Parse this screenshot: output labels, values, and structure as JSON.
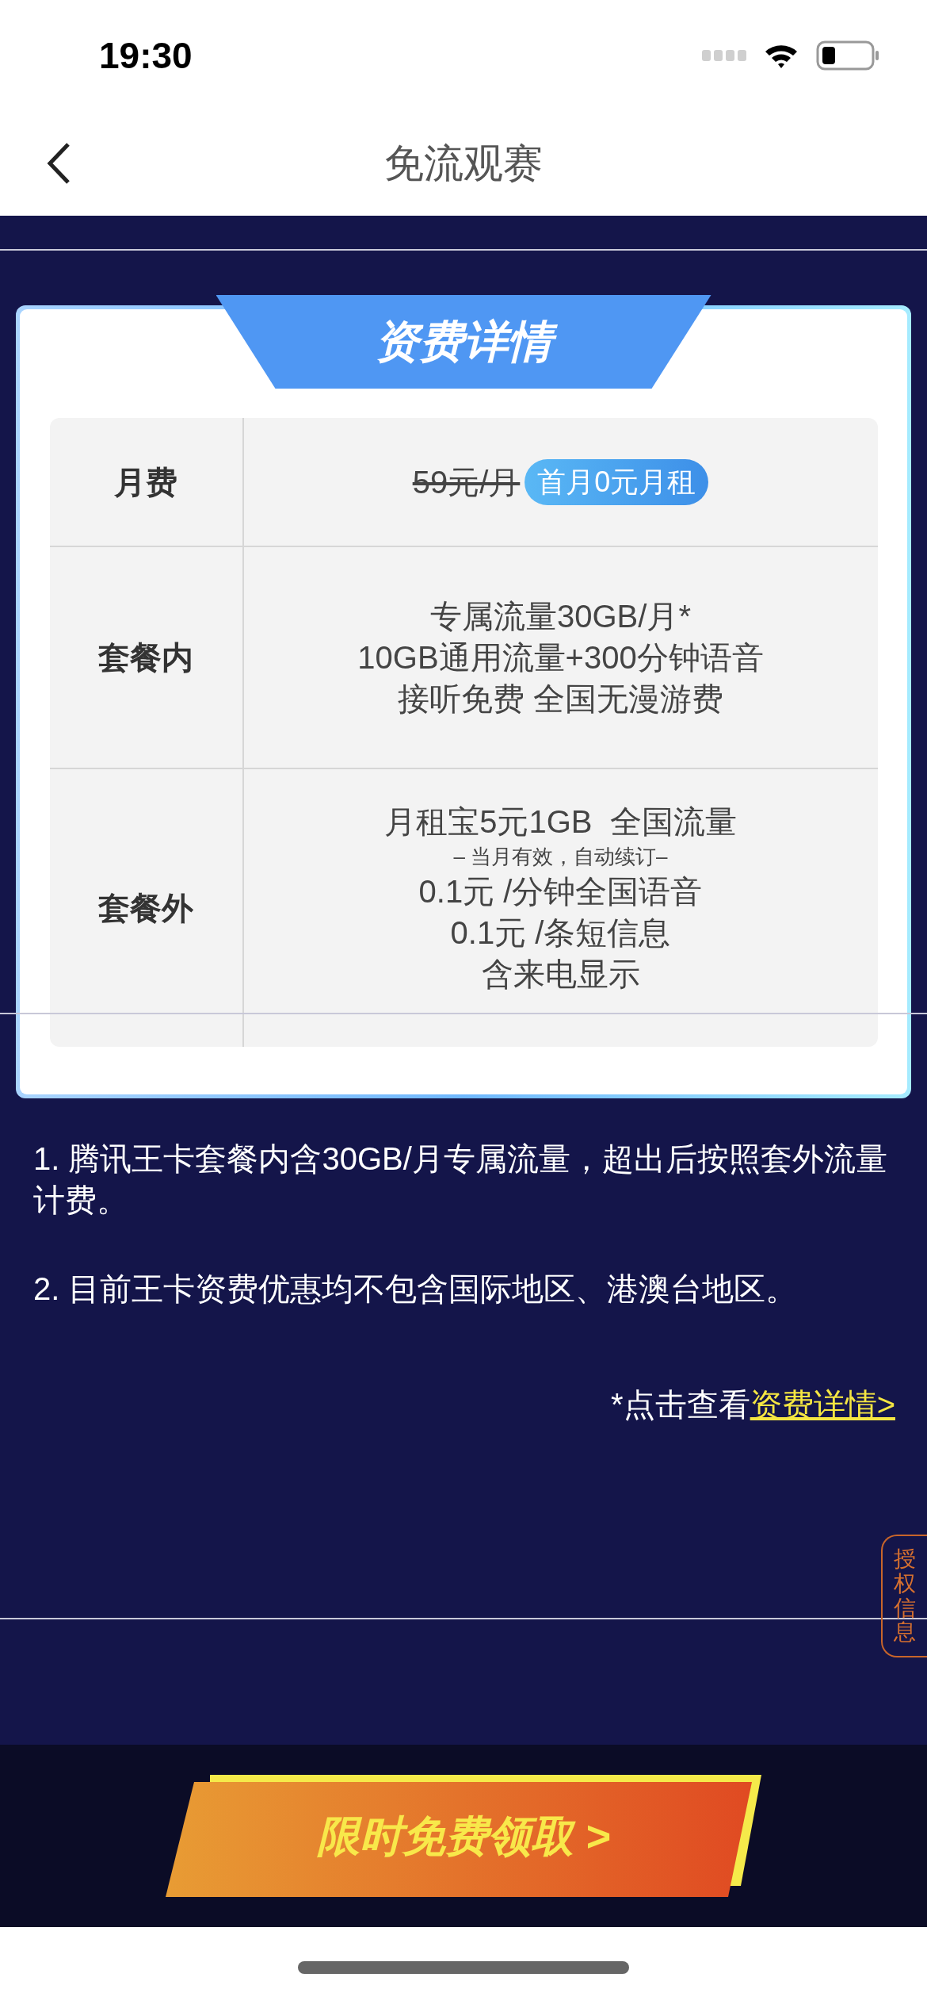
{
  "status_bar": {
    "time": "19:30"
  },
  "nav": {
    "title": "免流观赛"
  },
  "card": {
    "title": "资费详情",
    "rows": [
      {
        "label": "月费",
        "kind": "price",
        "old_price": "59元/月",
        "badge": "首月0元月租"
      },
      {
        "label": "套餐内",
        "kind": "lines",
        "lines": [
          {
            "text": "专属流量30GB/月*",
            "kind": "main"
          },
          {
            "text": "10GB通用流量+300分钟语音",
            "kind": "main"
          },
          {
            "text": "接听免费 全国无漫游费",
            "kind": "main"
          }
        ]
      },
      {
        "label": "套餐外",
        "kind": "lines",
        "lines": [
          {
            "text": "月租宝5元1GB  全国流量",
            "kind": "main"
          },
          {
            "text": "– 当月有效，自动续订–",
            "kind": "note"
          },
          {
            "text": "0.1元 /分钟全国语音",
            "kind": "main"
          },
          {
            "text": "0.1元 /条短信息",
            "kind": "main"
          },
          {
            "text": "含来电显示",
            "kind": "main"
          }
        ]
      }
    ]
  },
  "notes": [
    "1. 腾讯王卡套餐内含30GB/月专属流量，超出后按照套外流量计费。",
    "2. 目前王卡资费优惠均不包含国际地区、港澳台地区。"
  ],
  "details_link": {
    "prefix": "*点击查看",
    "link": "资费详情>"
  },
  "side_tab": {
    "label": "授权信息"
  },
  "cta_button": {
    "label": "限时免费领取 >"
  }
}
